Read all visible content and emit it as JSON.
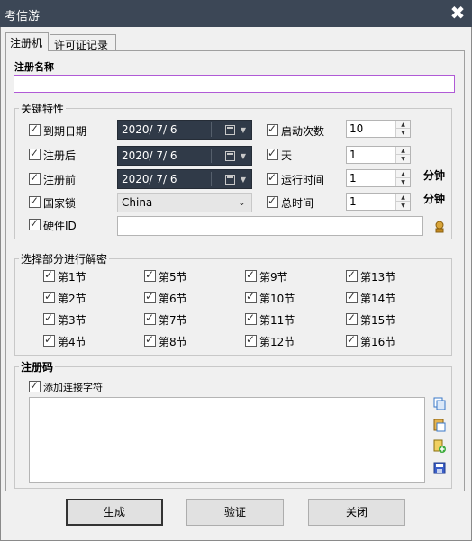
{
  "window": {
    "title": "考信游",
    "close_glyph": "✖"
  },
  "tabs": [
    {
      "label": "注册机"
    },
    {
      "label": "许可证记录"
    }
  ],
  "reg_name": {
    "label": "注册名称",
    "value": ""
  },
  "key_features": {
    "title": "关键特性",
    "expiry": {
      "label": "到期日期",
      "date": "2020/ 7/ 6"
    },
    "after_reg": {
      "label": "注册后",
      "date": "2020/ 7/ 6"
    },
    "before_reg": {
      "label": "注册前",
      "date": "2020/ 7/ 6"
    },
    "country_lock": {
      "label": "国家锁",
      "value": "China"
    },
    "hardware_id": {
      "label": "硬件ID",
      "value": ""
    },
    "launch_count": {
      "label": "启动次数",
      "value": "10"
    },
    "days": {
      "label": "天",
      "value": "1"
    },
    "run_time": {
      "label": "运行时间",
      "value": "1",
      "unit": "分钟"
    },
    "total_time": {
      "label": "总时间",
      "value": "1",
      "unit": "分钟"
    }
  },
  "sections": {
    "title": "选择部分进行解密",
    "items": [
      "第1节",
      "第2节",
      "第3节",
      "第4节",
      "第5节",
      "第6节",
      "第7节",
      "第8节",
      "第9节",
      "第10节",
      "第11节",
      "第12节",
      "第13节",
      "第14节",
      "第15节",
      "第16节"
    ]
  },
  "reg_code": {
    "label": "注册码",
    "add_sep_label": "添加连接字符",
    "value": ""
  },
  "buttons": {
    "generate": "生成",
    "verify": "验证",
    "close": "关闭"
  },
  "icons": [
    "copy-icon",
    "paste-icon",
    "add-file-icon",
    "save-icon",
    "hardware-fetch-icon"
  ]
}
